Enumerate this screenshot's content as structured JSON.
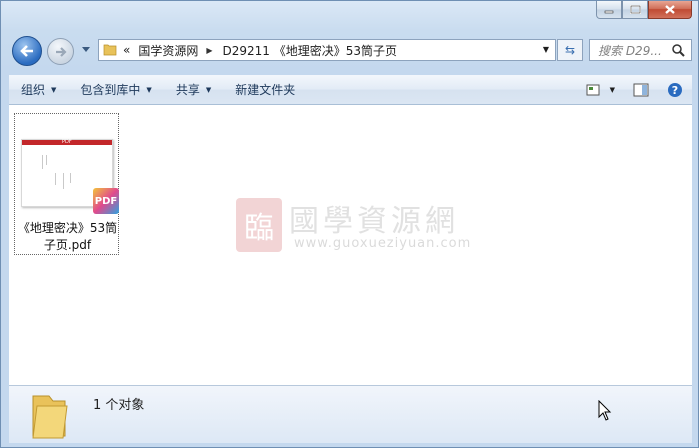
{
  "window": {
    "caption_buttons": [
      "minimize",
      "maximize",
      "close"
    ]
  },
  "address_bar": {
    "overflow": "«",
    "segments": [
      "国学资源网",
      "D29211 《地理密决》53筒子页"
    ]
  },
  "search": {
    "placeholder": "搜索 D29..."
  },
  "toolbar": {
    "organize": "组织",
    "include_in_library": "包含到库中",
    "share": "共享",
    "new_folder": "新建文件夹"
  },
  "files": [
    {
      "name": "《地理密决》53筒子页.pdf",
      "type_badge": "PDF",
      "thumb_header": "PDF"
    }
  ],
  "watermark": {
    "title": "國學資源網",
    "url": "www.guoxueziyuan.com",
    "logo_char": "臨"
  },
  "status": {
    "count": "1 个对象"
  },
  "colors": {
    "accent": "#1e395b",
    "pdf_red": "#c3272a",
    "watermark": "#e8b1b3"
  }
}
